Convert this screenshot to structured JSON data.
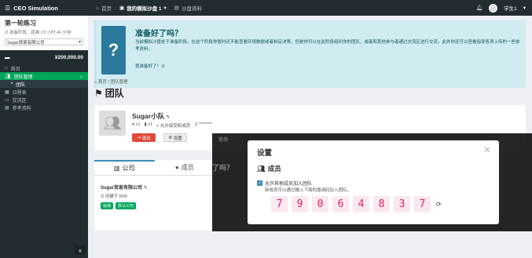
{
  "topbar": {
    "brand": "CEO Simulation",
    "nav": [
      {
        "label": "首页",
        "icon": "home-icon"
      },
      {
        "label": "我的模拟沙盘 1",
        "icon": "folder-icon"
      },
      {
        "label": "沙盘资料",
        "icon": "book-icon"
      }
    ],
    "user_name": "学生1"
  },
  "sidebar": {
    "round_title": "第一轮练习",
    "phase_text": "准备阶段，距离 23 小时 46 分钟",
    "company_select": "Sugar贸易有限公司",
    "money": "¥200,000.00",
    "items": [
      {
        "label": "首页",
        "icon": "home-icon"
      },
      {
        "label": "团队管理",
        "icon": "users-icon"
      },
      {
        "label": "团队",
        "icon": "dot-icon"
      },
      {
        "label": "日程表",
        "icon": "calendar-icon"
      },
      {
        "label": "交流区",
        "icon": "chat-icon"
      },
      {
        "label": "参考资料",
        "icon": "book-icon"
      }
    ]
  },
  "callout": {
    "title": "准备好了吗？",
    "text": "当前模拟沙盘处于准备阶段。在这个阶段你暂时还不能查看环境数据或者制定决策。但是你可以在此阶段组织你的团队，或者和其他参与者通过交流区进行交流，此外你还可以查看指导各项上传的一些参考资料。",
    "link": "我准备好了！②"
  },
  "breadcrumb": "首页 / 团队管理",
  "page_title": "团队",
  "team": {
    "name": "Sugar小队",
    "members": "x1",
    "docs": "x1",
    "allow_new": "允许接受新成员",
    "password": "********",
    "leave_label": "退出",
    "settings_label": "设置"
  },
  "tabs": {
    "company_tab": "公司",
    "members_tab": "成员"
  },
  "company": {
    "name": "Sugar贸易有限公司",
    "created": "创建于 R00",
    "tags": [
      "就绪",
      "默认公司"
    ]
  },
  "background": {
    "fragment1": "了吗？",
    "fragment2": "管理"
  },
  "modal": {
    "title": "设置",
    "section": "成员",
    "checkbox_label": "允许其他成员加入团队",
    "description": "新成员可以通过输入下面的邀请码加入团队。",
    "code_digits": [
      "7",
      "9",
      "0",
      "6",
      "4",
      "8",
      "3",
      "7"
    ]
  }
}
